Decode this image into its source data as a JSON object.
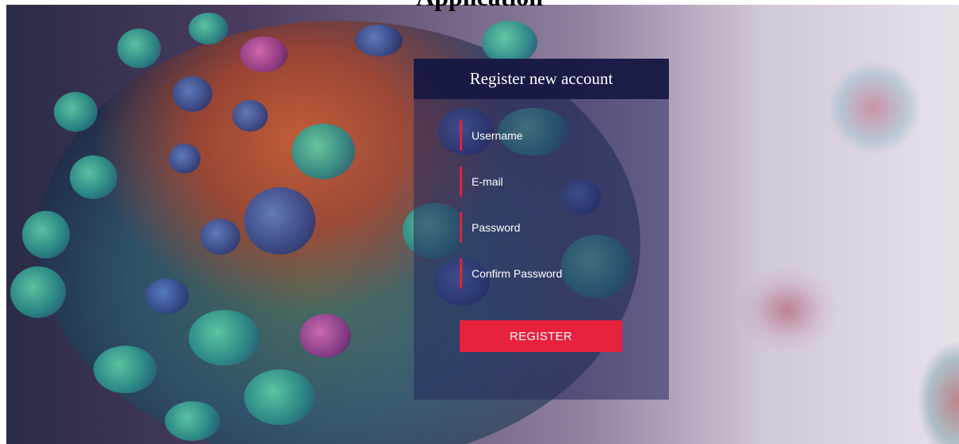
{
  "page": {
    "heading": "Application"
  },
  "register_form": {
    "title": "Register new account",
    "username_placeholder": "Username",
    "email_placeholder": "E-mail",
    "password_placeholder": "Password",
    "confirm_password_placeholder": "Confirm Password",
    "submit_label": "REGISTER"
  },
  "colors": {
    "accent": "#e8213c",
    "panel_header": "#16184a",
    "panel_body": "#26285c"
  }
}
